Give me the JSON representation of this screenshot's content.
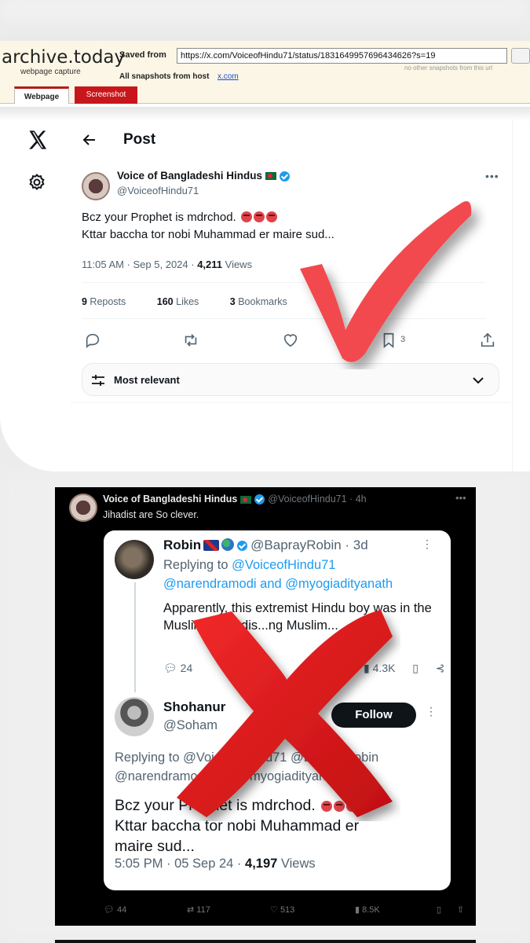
{
  "archive": {
    "logo": "archive.today",
    "subtitle": "webpage capture",
    "saved_from_label": "Saved from",
    "url": "https://x.com/VoiceofHindu71/status/1831649957696434626?s=19",
    "no_other": "no other snapshots from this url",
    "all_snapshots_label": "All snapshots  from host",
    "host_link": "x.com",
    "tab_webpage": "Webpage",
    "tab_screenshot": "Screenshot"
  },
  "post": {
    "header_title": "Post",
    "author_name": "Voice of Bangladeshi Hindus",
    "author_handle": "@VoiceofHindu71",
    "text_line1": "Bcz your Prophet is mdrchod.",
    "text_line2": "Kttar baccha tor nobi Muhammad er maire sud...",
    "time": "11:05 AM · Sep 5, 2024 · ",
    "views_count": "4,211",
    "views_label": " Views",
    "reposts_count": "9",
    "reposts_label": " Reposts",
    "likes_count": "160",
    "likes_label": " Likes",
    "bookmarks_count": "3",
    "bookmarks_label": " Bookmarks",
    "bookmark_action_count": "3",
    "sort_label": "Most relevant"
  },
  "dark_tweet": {
    "author_name": "Voice of Bangladeshi Hindus",
    "author_handle": "@VoiceofHindu71 · 4h",
    "text": "Jihadist are So clever.",
    "actions": {
      "replies": "44",
      "reposts": "117",
      "likes": "513",
      "views": "8.5K"
    }
  },
  "quoted": {
    "reply1_name": "Robin",
    "reply1_handle": "@BaprayRobin · 3d",
    "reply1_replying_prefix": "Replying to ",
    "reply1_replying_to": "@VoiceofHindu71",
    "reply1_replying_more": "@narendramodi and @myogiadityanath",
    "reply1_body": "Apparently, this extremist Hindu boy was in the Muslim pro... dis...ng Muslim...",
    "reply1_replies": "24",
    "reply1_views": "4.3K",
    "reply2_name": "Shohanur",
    "reply2_handle": "@Soham",
    "follow_label": "Follow",
    "reply2_replying": "Replying to @VoiceofHindu71 @BaprayRobin @narendramodi and @myogiadityanath",
    "reply2_body_line1": "Bcz your Prophet is mdrchod.",
    "reply2_body_line2": "Kttar baccha tor nobi Muhammad er",
    "reply2_body_line3": "maire sud...",
    "reply2_time": "5:05 PM · 05 Sep 24 · ",
    "reply2_views_count": "4,197",
    "reply2_views_label": " Views"
  },
  "colors": {
    "accent": "#1d9bf0",
    "check_red": "#f24a4f",
    "cross_red": "#e0191c",
    "archive_red": "#c8171c"
  }
}
